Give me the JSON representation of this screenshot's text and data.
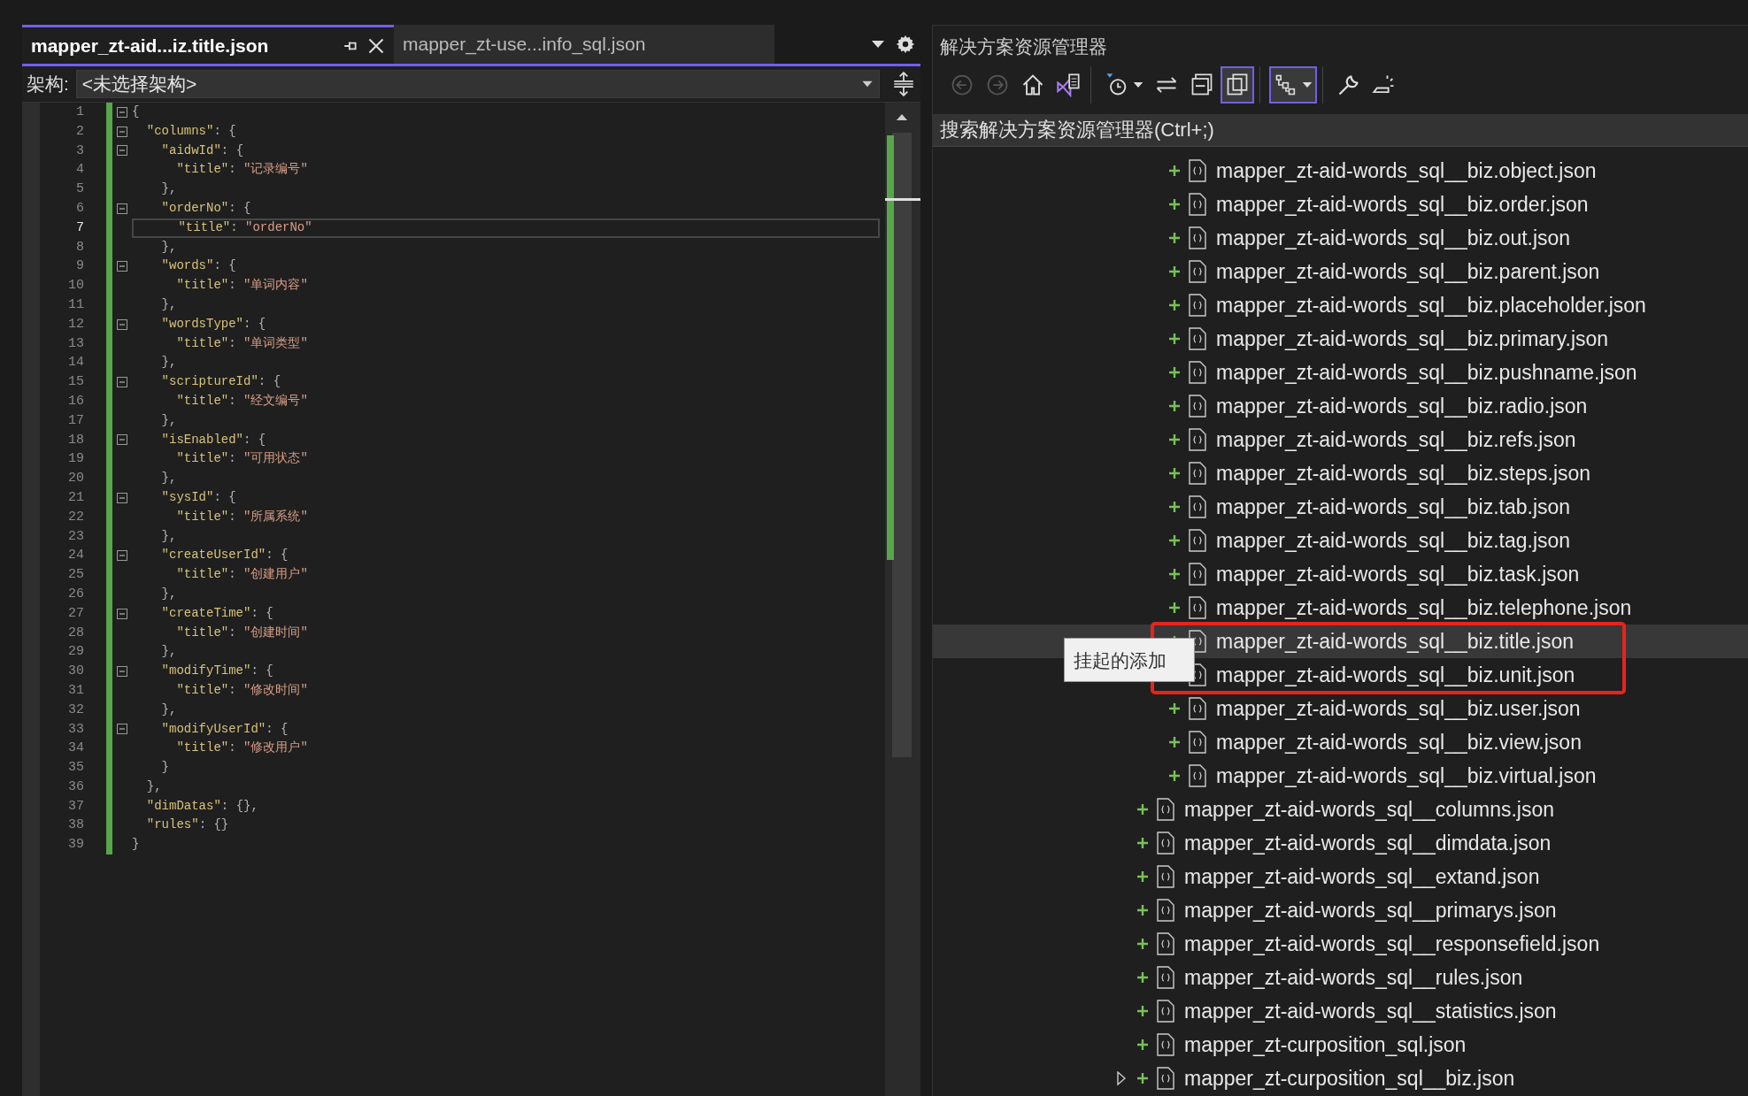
{
  "editor": {
    "tabs": [
      {
        "label": "mapper_zt-aid...iz.title.json",
        "selected": true
      },
      {
        "label": "mapper_zt-use...info_sql.json",
        "selected": false
      }
    ],
    "nav_bar": {
      "label": "架构:",
      "value": "<未选择架构>"
    },
    "lines": [
      {
        "number": "1",
        "text": "{",
        "changed": true,
        "current": false
      },
      {
        "number": "2",
        "text": "  \"columns\": {",
        "changed": true,
        "current": false
      },
      {
        "number": "3",
        "text": "    \"aidwId\": {",
        "changed": true,
        "current": false
      },
      {
        "number": "4",
        "text": "      \"title\": \"记录编号\"",
        "changed": true,
        "current": false
      },
      {
        "number": "5",
        "text": "    },",
        "changed": true,
        "current": false
      },
      {
        "number": "6",
        "text": "    \"orderNo\": {",
        "changed": true,
        "current": false
      },
      {
        "number": "7",
        "text": "      \"title\": \"orderNo\"",
        "changed": true,
        "current": true
      },
      {
        "number": "8",
        "text": "    },",
        "changed": true,
        "current": false
      },
      {
        "number": "9",
        "text": "    \"words\": {",
        "changed": true,
        "current": false
      },
      {
        "number": "10",
        "text": "      \"title\": \"单词内容\"",
        "changed": true,
        "current": false
      },
      {
        "number": "11",
        "text": "    },",
        "changed": true,
        "current": false
      },
      {
        "number": "12",
        "text": "    \"wordsType\": {",
        "changed": true,
        "current": false
      },
      {
        "number": "13",
        "text": "      \"title\": \"单词类型\"",
        "changed": true,
        "current": false
      },
      {
        "number": "14",
        "text": "    },",
        "changed": true,
        "current": false
      },
      {
        "number": "15",
        "text": "    \"scriptureId\": {",
        "changed": true,
        "current": false
      },
      {
        "number": "16",
        "text": "      \"title\": \"经文编号\"",
        "changed": true,
        "current": false
      },
      {
        "number": "17",
        "text": "    },",
        "changed": true,
        "current": false
      },
      {
        "number": "18",
        "text": "    \"isEnabled\": {",
        "changed": true,
        "current": false
      },
      {
        "number": "19",
        "text": "      \"title\": \"可用状态\"",
        "changed": true,
        "current": false
      },
      {
        "number": "20",
        "text": "    },",
        "changed": true,
        "current": false
      },
      {
        "number": "21",
        "text": "    \"sysId\": {",
        "changed": true,
        "current": false
      },
      {
        "number": "22",
        "text": "      \"title\": \"所属系统\"",
        "changed": true,
        "current": false
      },
      {
        "number": "23",
        "text": "    },",
        "changed": true,
        "current": false
      },
      {
        "number": "24",
        "text": "    \"createUserId\": {",
        "changed": true,
        "current": false
      },
      {
        "number": "25",
        "text": "      \"title\": \"创建用户\"",
        "changed": true,
        "current": false
      },
      {
        "number": "26",
        "text": "    },",
        "changed": true,
        "current": false
      },
      {
        "number": "27",
        "text": "    \"createTime\": {",
        "changed": true,
        "current": false
      },
      {
        "number": "28",
        "text": "      \"title\": \"创建时间\"",
        "changed": true,
        "current": false
      },
      {
        "number": "29",
        "text": "    },",
        "changed": true,
        "current": false
      },
      {
        "number": "30",
        "text": "    \"modifyTime\": {",
        "changed": true,
        "current": false
      },
      {
        "number": "31",
        "text": "      \"title\": \"修改时间\"",
        "changed": true,
        "current": false
      },
      {
        "number": "32",
        "text": "    },",
        "changed": true,
        "current": false
      },
      {
        "number": "33",
        "text": "    \"modifyUserId\": {",
        "changed": true,
        "current": false
      },
      {
        "number": "34",
        "text": "      \"title\": \"修改用户\"",
        "changed": true,
        "current": false
      },
      {
        "number": "35",
        "text": "    }",
        "changed": true,
        "current": false
      },
      {
        "number": "36",
        "text": "  },",
        "changed": true,
        "current": false
      },
      {
        "number": "37",
        "text": "  \"dimDatas\": {},",
        "changed": true,
        "current": false
      },
      {
        "number": "38",
        "text": "  \"rules\": {}",
        "changed": true,
        "current": false
      },
      {
        "number": "39",
        "text": "}",
        "changed": true,
        "current": false
      }
    ]
  },
  "solution_explorer": {
    "title": "解决方案资源管理器",
    "toolbar": [
      [
        {
          "kind": "back",
          "disabled": true,
          "selected": false,
          "dropdown": false
        },
        {
          "kind": "forward",
          "disabled": true,
          "selected": false,
          "dropdown": false
        },
        {
          "kind": "home",
          "disabled": false,
          "selected": false,
          "dropdown": false
        },
        {
          "kind": "solution",
          "disabled": false,
          "selected": false,
          "dropdown": false
        }
      ],
      [
        {
          "kind": "history",
          "disabled": false,
          "selected": false,
          "dropdown": true
        },
        {
          "kind": "sync",
          "disabled": false,
          "selected": false,
          "dropdown": false
        },
        {
          "kind": "collapse",
          "disabled": false,
          "selected": false,
          "dropdown": false
        },
        {
          "kind": "show_all",
          "disabled": false,
          "selected": true,
          "dropdown": false
        }
      ],
      [
        {
          "kind": "view",
          "disabled": false,
          "selected": true,
          "dropdown": true
        }
      ],
      [
        {
          "kind": "properties",
          "disabled": false,
          "selected": false,
          "dropdown": false
        },
        {
          "kind": "preview",
          "disabled": false,
          "selected": false,
          "dropdown": false
        }
      ]
    ],
    "search": {
      "placeholder": "搜索解决方案资源管理器(Ctrl+;)"
    },
    "tree": [
      {
        "children": [
          {
            "label": "mapper_zt-aid-words_sql__biz.object.json",
            "kind": "file",
            "pending_add": true,
            "selected": false
          },
          {
            "label": "mapper_zt-aid-words_sql__biz.order.json",
            "kind": "file",
            "pending_add": true,
            "selected": false
          },
          {
            "label": "mapper_zt-aid-words_sql__biz.out.json",
            "kind": "file",
            "pending_add": true,
            "selected": false
          },
          {
            "label": "mapper_zt-aid-words_sql__biz.parent.json",
            "kind": "file",
            "pending_add": true,
            "selected": false
          },
          {
            "label": "mapper_zt-aid-words_sql__biz.placeholder.json",
            "kind": "file",
            "pending_add": true,
            "selected": false
          },
          {
            "label": "mapper_zt-aid-words_sql__biz.primary.json",
            "kind": "file",
            "pending_add": true,
            "selected": false
          },
          {
            "label": "mapper_zt-aid-words_sql__biz.pushname.json",
            "kind": "file",
            "pending_add": true,
            "selected": false
          },
          {
            "label": "mapper_zt-aid-words_sql__biz.radio.json",
            "kind": "file",
            "pending_add": true,
            "selected": false
          },
          {
            "label": "mapper_zt-aid-words_sql__biz.refs.json",
            "kind": "file",
            "pending_add": true,
            "selected": false
          },
          {
            "label": "mapper_zt-aid-words_sql__biz.steps.json",
            "kind": "file",
            "pending_add": true,
            "selected": false
          },
          {
            "label": "mapper_zt-aid-words_sql__biz.tab.json",
            "kind": "file",
            "pending_add": true,
            "selected": false
          },
          {
            "label": "mapper_zt-aid-words_sql__biz.tag.json",
            "kind": "file",
            "pending_add": true,
            "selected": false
          },
          {
            "label": "mapper_zt-aid-words_sql__biz.task.json",
            "kind": "file",
            "pending_add": true,
            "selected": false
          },
          {
            "label": "mapper_zt-aid-words_sql__biz.telephone.json",
            "kind": "file",
            "pending_add": true,
            "selected": false
          },
          {
            "label": "mapper_zt-aid-words_sql__biz.title.json",
            "kind": "file",
            "pending_add": true,
            "selected": true
          },
          {
            "label": "mapper_zt-aid-words_sql__biz.unit.json",
            "kind": "file",
            "selected": false
          },
          {
            "label": "mapper_zt-aid-words_sql__biz.user.json",
            "kind": "file",
            "pending_add": true,
            "selected": false
          },
          {
            "label": "mapper_zt-aid-words_sql__biz.view.json",
            "kind": "file",
            "pending_add": true,
            "selected": false
          },
          {
            "label": "mapper_zt-aid-words_sql__biz.virtual.json",
            "kind": "file",
            "pending_add": true,
            "selected": false
          }
        ]
      },
      {
        "label": "mapper_zt-aid-words_sql__columns.json",
        "kind": "file",
        "pending_add": true,
        "selected": false
      },
      {
        "label": "mapper_zt-aid-words_sql__dimdata.json",
        "kind": "file",
        "pending_add": true,
        "selected": false
      },
      {
        "label": "mapper_zt-aid-words_sql__extand.json",
        "kind": "file",
        "pending_add": true,
        "selected": false
      },
      {
        "label": "mapper_zt-aid-words_sql__primarys.json",
        "kind": "file",
        "pending_add": true,
        "selected": false
      },
      {
        "label": "mapper_zt-aid-words_sql__responsefield.json",
        "kind": "file",
        "pending_add": true,
        "selected": false
      },
      {
        "label": "mapper_zt-aid-words_sql__rules.json",
        "kind": "file",
        "pending_add": true,
        "selected": false
      },
      {
        "label": "mapper_zt-aid-words_sql__statistics.json",
        "kind": "file",
        "pending_add": true,
        "selected": false
      },
      {
        "label": "mapper_zt-curposition_sql.json",
        "kind": "file",
        "pending_add": true,
        "selected": false
      },
      {
        "label": "mapper_zt-curposition_sql__biz.json",
        "kind": "collapsed",
        "pending_add": true,
        "selected": false
      }
    ],
    "tooltip": {
      "text": "挂起的添加"
    },
    "annotation": {
      "kind": "rectangle"
    }
  }
}
